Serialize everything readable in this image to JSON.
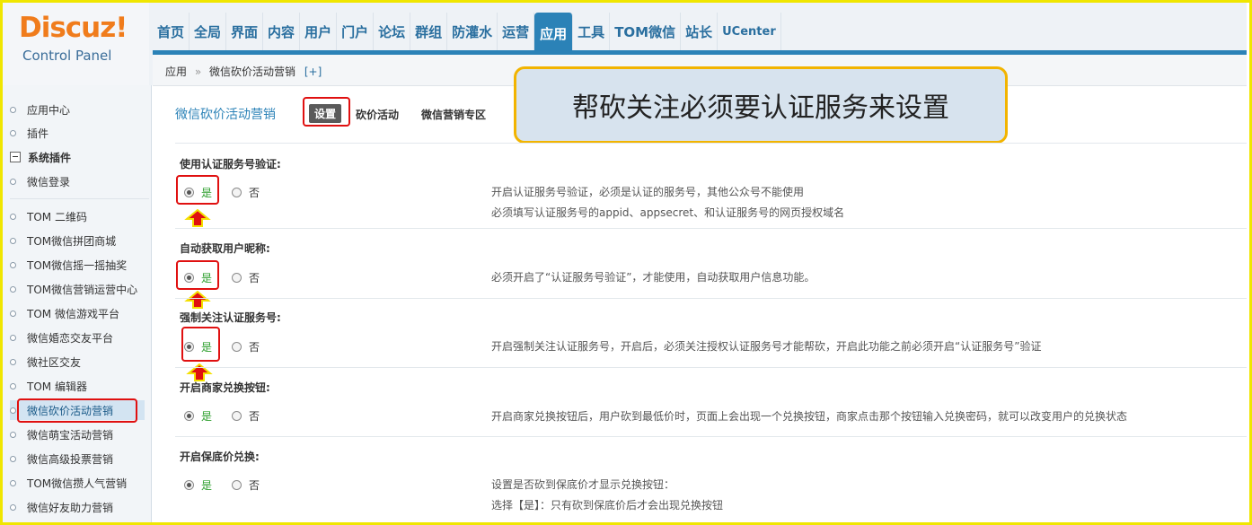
{
  "logo": {
    "brand": "Discuz!",
    "subtitle": "Control Panel"
  },
  "nav": [
    "首页",
    "全局",
    "界面",
    "内容",
    "用户",
    "门户",
    "论坛",
    "群组",
    "防灌水",
    "运营",
    "应用",
    "工具",
    "TOM微信",
    "站长",
    "UCenter"
  ],
  "nav_active": "应用",
  "breadcrumb": {
    "root": "应用",
    "sep": "»",
    "current": "微信砍价活动营销",
    "plus": "[+]"
  },
  "sidebar": {
    "items": [
      "应用中心",
      "插件",
      "系统插件",
      "微信登录",
      "TOM 二维码",
      "TOM微信拼团商城",
      "TOM微信摇一摇抽奖",
      "TOM微信营销运营中心",
      "TOM 微信游戏平台",
      "微信婚恋交友平台",
      "微社区交友",
      "TOM 编辑器",
      "微信砍价活动营销",
      "微信萌宝活动营销",
      "微信高级投票营销",
      "TOM微信攒人气营销",
      "微信好友助力营销"
    ]
  },
  "main": {
    "title": "微信砍价活动营销",
    "tabs": [
      "设置",
      "砍价活动",
      "微信营销专区"
    ],
    "callout": "帮砍关注必须要认证服务来设置",
    "yes": "是",
    "no": "否",
    "fields": [
      {
        "label": "使用认证服务号验证:",
        "value": "是",
        "desc1": "开启认证服务号验证，必须是认证的服务号，其他公众号不能使用",
        "desc2": "必须填写认证服务号的appid、appsecret、和认证服务号的网页授权域名"
      },
      {
        "label": "自动获取用户昵称:",
        "value": "是",
        "desc1": "必须开启了“认证服务号验证”，才能使用，自动获取用户信息功能。"
      },
      {
        "label": "强制关注认证服务号:",
        "value": "是",
        "desc1": "开启强制关注认证服务号，开启后，必须关注授权认证服务号才能帮砍，开启此功能之前必须开启“认证服务号”验证"
      },
      {
        "label": "开启商家兑换按钮:",
        "value": "是",
        "desc1": "开启商家兑换按钮后，用户砍到最低价时，页面上会出现一个兑换按钮，商家点击那个按钮输入兑换密码，就可以改变用户的兑换状态"
      },
      {
        "label": "开启保底价兑换:",
        "value": "是",
        "desc1": "设置是否砍到保底价才显示兑换按钮：",
        "desc2": "选择【是】：只有砍到保底价后才会出现兑换按钮"
      }
    ]
  },
  "colors": {
    "accent": "#2b82b7",
    "logo_orange": "#f07c1c",
    "highlight_red": "#e01010",
    "callout_border": "#f2b400"
  }
}
